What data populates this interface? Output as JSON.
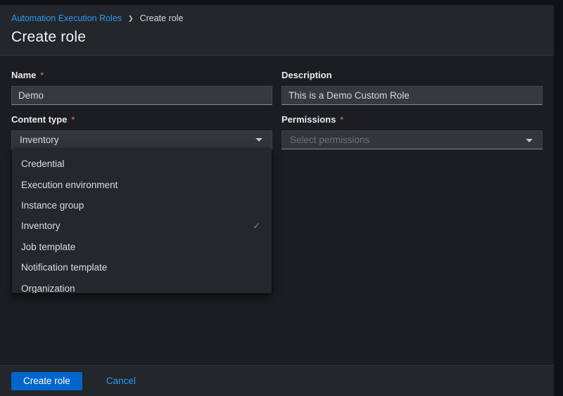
{
  "breadcrumb": {
    "items": [
      {
        "label": "Automation Execution Roles"
      },
      {
        "label": "Create role"
      }
    ],
    "separator": "❯"
  },
  "page": {
    "title": "Create role"
  },
  "form": {
    "required_indicator": "*",
    "fields": {
      "name": {
        "label": "Name",
        "required": true,
        "value": "Demo"
      },
      "description": {
        "label": "Description",
        "required": false,
        "value": "This is a Demo Custom Role"
      },
      "content_type": {
        "label": "Content type",
        "required": true,
        "value": "Inventory",
        "expanded": true
      },
      "permissions": {
        "label": "Permissions",
        "required": true,
        "placeholder": "Select permissions"
      }
    }
  },
  "content_type_menu": {
    "check_icon": "✓",
    "options": [
      {
        "label": "Credential",
        "selected": false
      },
      {
        "label": "Execution environment",
        "selected": false
      },
      {
        "label": "Instance group",
        "selected": false
      },
      {
        "label": "Inventory",
        "selected": true
      },
      {
        "label": "Job template",
        "selected": false
      },
      {
        "label": "Notification template",
        "selected": false
      },
      {
        "label": "Organization",
        "selected": false
      }
    ]
  },
  "footer": {
    "submit_label": "Create role",
    "cancel_label": "Cancel"
  },
  "colors": {
    "accent_blue": "#2b9af3",
    "primary_button": "#0066cc",
    "required_red": "#c4574b",
    "header_bg": "#23262a",
    "main_bg": "#1b1d21",
    "menu_bg": "#24272c"
  }
}
